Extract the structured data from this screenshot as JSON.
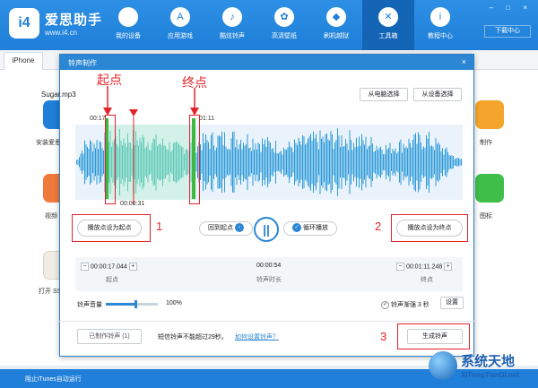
{
  "app": {
    "brand": "爱思助手",
    "site": "www.i4.cn",
    "logo": "i4",
    "download_center": "下载中心",
    "window_controls": "– □ ×"
  },
  "nav": [
    {
      "label": "我的设备",
      "icon": "apple-icon",
      "glyph": ""
    },
    {
      "label": "应用游戏",
      "icon": "app-store-icon",
      "glyph": "A"
    },
    {
      "label": "酷炫铃声",
      "icon": "bell-icon",
      "glyph": "♪"
    },
    {
      "label": "高清壁纸",
      "icon": "flower-icon",
      "glyph": "✿"
    },
    {
      "label": "刷机越狱",
      "icon": "dropbox-icon",
      "glyph": "◆"
    },
    {
      "label": "工具箱",
      "icon": "tools-icon",
      "glyph": "✕"
    },
    {
      "label": "教程中心",
      "icon": "info-icon",
      "glyph": "i"
    }
  ],
  "tabs": {
    "device": "iPhone"
  },
  "background": {
    "labels": [
      "安装爱思",
      "视频",
      "打开 SS",
      "制作",
      "图标"
    ],
    "status": "阻止iTunes自动运行"
  },
  "dialog": {
    "title": "铃声制作",
    "close": "×",
    "filename": "Sugar.mp3",
    "from_pc": "从电脑选择",
    "from_device": "从设备选择",
    "time_start_marker": "00:17",
    "time_end_marker": "01:11",
    "time_playhead": "00:00:31",
    "set_start": "播放点设为起点",
    "set_end": "播放点设为终点",
    "back_to_start": "回到起点",
    "loop_play": "循环播放",
    "start_time": "00:00:17.044",
    "start_label": "起点",
    "duration": "00:00:54",
    "duration_label": "铃声时长",
    "end_time": "00:01:11.248",
    "end_label": "终点",
    "minus": "−",
    "plus": "+",
    "volume_label": "铃声音量",
    "volume_percent": "100%",
    "volume": 1.0,
    "fade_label": "铃声渐强 3 秒",
    "settings": "设置",
    "made_count": "已制作铃声 (1)",
    "note": "短信铃声不能超过29秒。",
    "how_to": "如何设置铃声？",
    "generate": "生成铃声"
  },
  "annotations": {
    "start": "起点",
    "end": "终点",
    "n1": "1",
    "n2": "2",
    "n3": "3"
  },
  "watermark": {
    "main": "系统天地",
    "sub": "XiTongTianDi.net"
  },
  "colors": {
    "primary": "#1f7fd9",
    "wave": "#2b9ad8",
    "selection": "#7fd6c2",
    "marker": "#3fb83f",
    "annotation": "#e3242b"
  }
}
